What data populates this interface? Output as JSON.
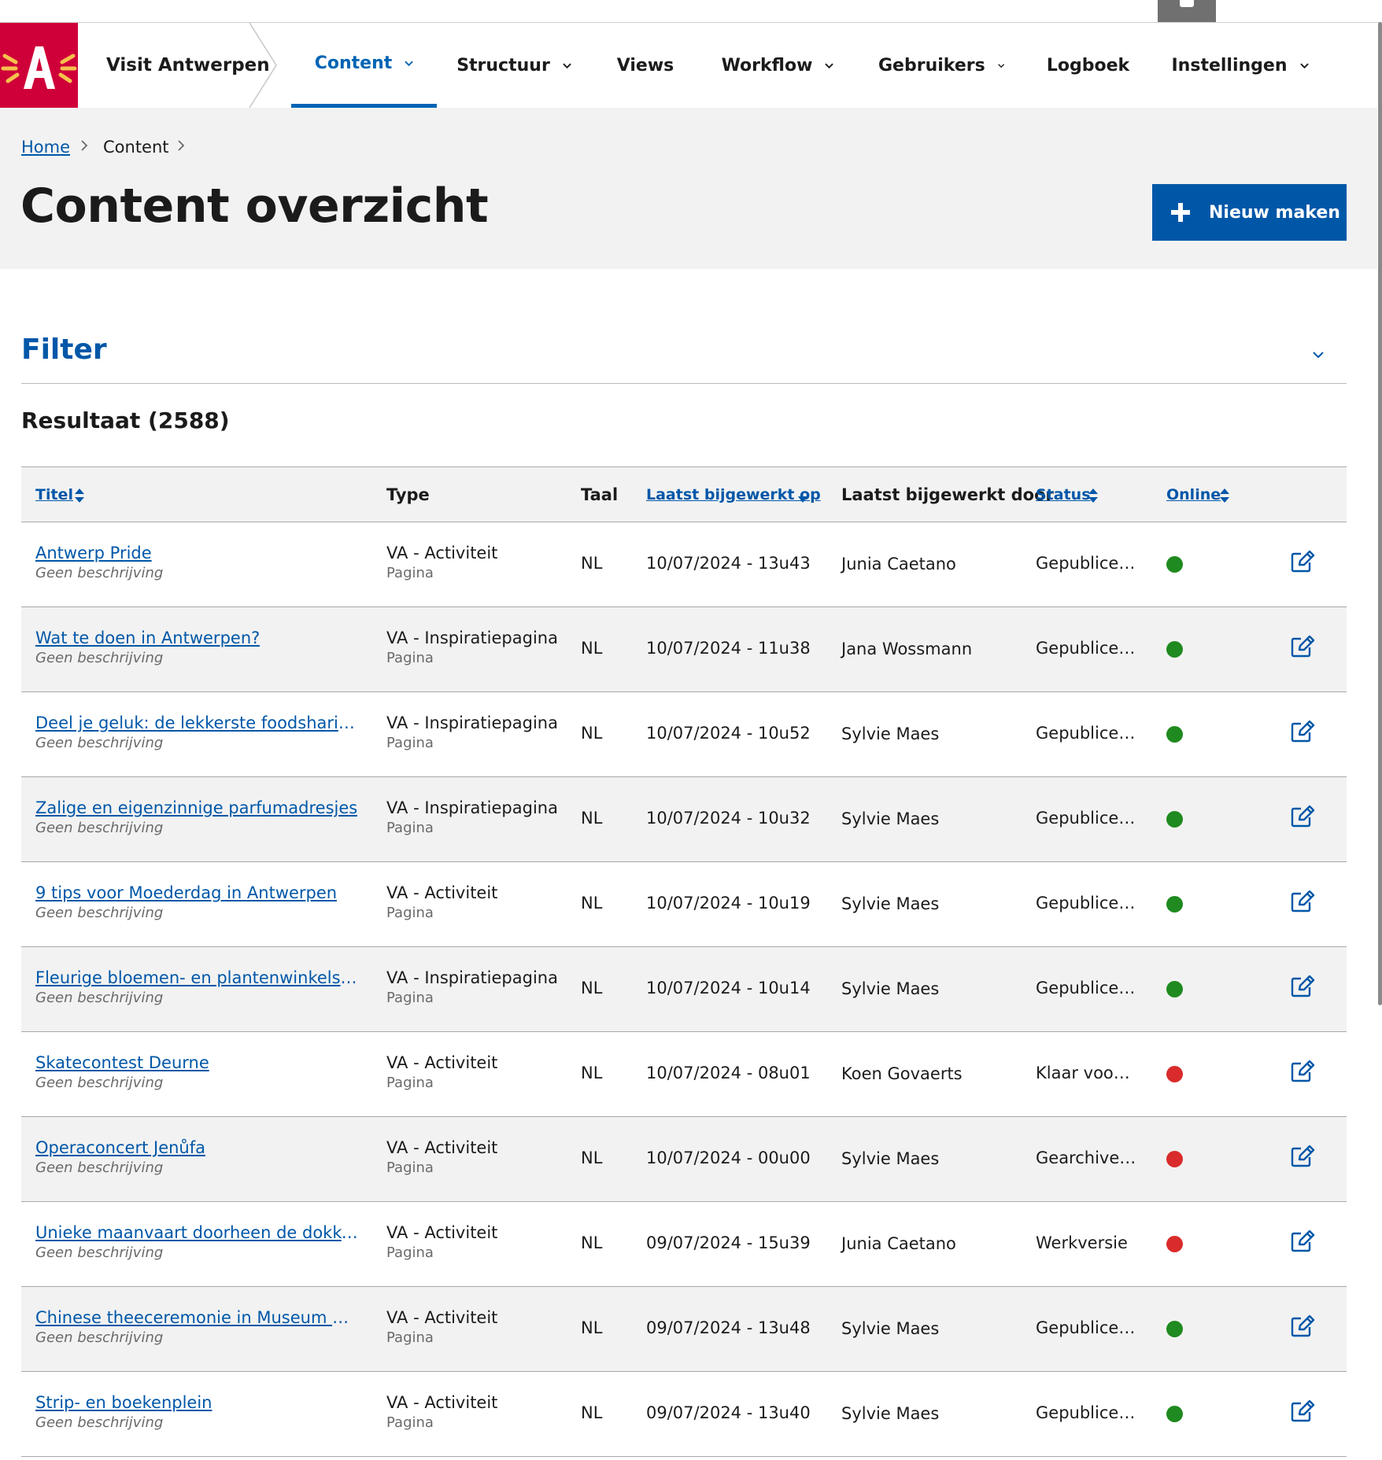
{
  "header": {
    "site_name": "Visit Antwerpen",
    "nav": [
      {
        "label": "Content"
      },
      {
        "label": "Structuur"
      },
      {
        "label": "Views"
      },
      {
        "label": "Workflow"
      },
      {
        "label": "Gebruikers"
      },
      {
        "label": "Logboek"
      },
      {
        "label": "Instellingen"
      }
    ]
  },
  "breadcrumb": {
    "home": "Home",
    "current": "Content"
  },
  "page": {
    "title": "Content overzicht",
    "new_button": "Nieuw maken"
  },
  "filter": {
    "title": "Filter"
  },
  "result": {
    "title": "Resultaat (2588)"
  },
  "table": {
    "headers": {
      "title": "Titel",
      "type": "Type",
      "lang": "Taal",
      "updated_on": "Laatst bijgewerkt op",
      "updated_by": "Laatst bijgewerkt door",
      "status": "Status",
      "online": "Online"
    },
    "rows": [
      {
        "title": "Antwerp Pride",
        "desc": "Geen beschrijving",
        "type": "VA - Activiteit",
        "subtype": "Pagina",
        "lang": "NL",
        "date": "10/07/2024 - 13u43",
        "user": "Junia Caetano",
        "status": "Gepubliceerd",
        "online": "green"
      },
      {
        "title": "Wat te doen in Antwerpen?",
        "desc": "Geen beschrijving",
        "type": "VA - Inspiratiepagina",
        "subtype": "Pagina",
        "lang": "NL",
        "date": "10/07/2024 - 11u38",
        "user": "Jana Wossmann",
        "status": "Gepubliceerd",
        "online": "green"
      },
      {
        "title": "Deel je geluk: de lekkerste foodsharing ...",
        "desc": "Geen beschrijving",
        "type": "VA - Inspiratiepagina",
        "subtype": "Pagina",
        "lang": "NL",
        "date": "10/07/2024 - 10u52",
        "user": "Sylvie Maes",
        "status": "Gepubliceerd",
        "online": "green"
      },
      {
        "title": "Zalige en eigenzinnige parfumadresjes",
        "desc": "Geen beschrijving",
        "type": "VA - Inspiratiepagina",
        "subtype": "Pagina",
        "lang": "NL",
        "date": "10/07/2024 - 10u32",
        "user": "Sylvie Maes",
        "status": "Gepubliceerd",
        "online": "green"
      },
      {
        "title": "9 tips voor Moederdag in Antwerpen",
        "desc": "Geen beschrijving",
        "type": "VA - Activiteit",
        "subtype": "Pagina",
        "lang": "NL",
        "date": "10/07/2024 - 10u19",
        "user": "Sylvie Maes",
        "status": "Gepubliceerd",
        "online": "green"
      },
      {
        "title": "Fleurige bloemen- en plantenwinkels in...",
        "desc": "Geen beschrijving",
        "type": "VA - Inspiratiepagina",
        "subtype": "Pagina",
        "lang": "NL",
        "date": "10/07/2024 - 10u14",
        "user": "Sylvie Maes",
        "status": "Gepubliceerd",
        "online": "green"
      },
      {
        "title": "Skatecontest Deurne",
        "desc": "Geen beschrijving",
        "type": "VA - Activiteit",
        "subtype": "Pagina",
        "lang": "NL",
        "date": "10/07/2024 - 08u01",
        "user": "Koen Govaerts",
        "status": "Klaar voor review",
        "online": "red"
      },
      {
        "title": "Operaconcert Jenůfa",
        "desc": "Geen beschrijving",
        "type": "VA - Activiteit",
        "subtype": "Pagina",
        "lang": "NL",
        "date": "10/07/2024 - 00u00",
        "user": "Sylvie Maes",
        "status": "Gearchiveerd",
        "online": "red"
      },
      {
        "title": "Unieke maanvaart doorheen de dokken...",
        "desc": "Geen beschrijving",
        "type": "VA - Activiteit",
        "subtype": "Pagina",
        "lang": "NL",
        "date": "09/07/2024 - 15u39",
        "user": "Junia Caetano",
        "status": "Werkversie",
        "online": "red"
      },
      {
        "title": "Chinese theeceremonie in Museum Ma...",
        "desc": "Geen beschrijving",
        "type": "VA - Activiteit",
        "subtype": "Pagina",
        "lang": "NL",
        "date": "09/07/2024 - 13u48",
        "user": "Sylvie Maes",
        "status": "Gepubliceerd",
        "online": "green"
      },
      {
        "title": "Strip- en boekenplein",
        "desc": "Geen beschrijving",
        "type": "VA - Activiteit",
        "subtype": "Pagina",
        "lang": "NL",
        "date": "09/07/2024 - 13u40",
        "user": "Sylvie Maes",
        "status": "Gepubliceerd",
        "online": "green"
      }
    ]
  },
  "colors": {
    "brand_red": "#cf0039",
    "accent_blue": "#0057a8",
    "online_green": "#1f8a1f",
    "online_red": "#d92b2b"
  },
  "icons": {
    "edit": "edit-icon",
    "sort": "sort-icon",
    "plus": "plus-icon",
    "chevron": "chevron-down-icon"
  }
}
